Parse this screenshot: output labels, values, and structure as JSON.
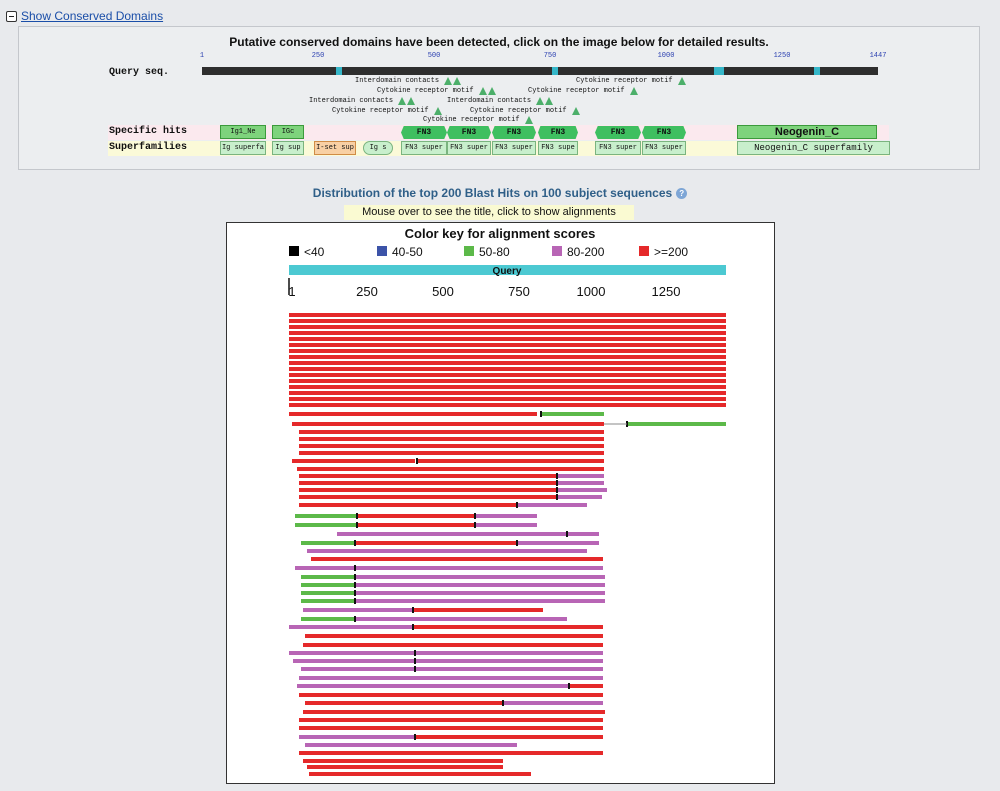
{
  "toggle": {
    "label": "Show Conserved Domains"
  },
  "conserved_domains": {
    "header": "Putative conserved domains have been detected, click on the image below for detailed results.",
    "query_label": "Query seq.",
    "specific_hits_label": "Specific hits",
    "superfamilies_label": "Superfamilies",
    "ruler_ticks": [
      "1",
      "250",
      "500",
      "750",
      "1000",
      "1250",
      "1447"
    ],
    "motif_rows": [
      [
        {
          "text": "Interdomain contacts",
          "tri": [
            1,
            2
          ]
        },
        {
          "text": "Cytokine receptor motif",
          "tri": [
            1
          ]
        }
      ],
      [
        {
          "text": "Cytokine receptor motif",
          "tri": [
            1,
            2
          ]
        },
        {
          "text": "Cytokine receptor motif",
          "tri": [
            1
          ]
        }
      ],
      [
        {
          "text": "Interdomain contacts",
          "tri": [
            1,
            2
          ]
        },
        {
          "text": "Interdomain contacts",
          "tri": [
            1,
            2
          ]
        }
      ],
      [
        {
          "text": "Cytokine receptor motif",
          "tri": [
            1
          ]
        },
        {
          "text": "Cytokine receptor motif",
          "tri": [
            1
          ]
        }
      ],
      [
        {
          "text": "Cytokine receptor motif",
          "tri": [
            1
          ]
        }
      ]
    ],
    "specific_hits": [
      {
        "label": "Ig1_Ne",
        "kind": "box"
      },
      {
        "label": "IGc",
        "kind": "box"
      },
      {
        "label": "FN3",
        "kind": "fn3"
      },
      {
        "label": "FN3",
        "kind": "fn3"
      },
      {
        "label": "FN3",
        "kind": "fn3"
      },
      {
        "label": "FN3",
        "kind": "fn3"
      },
      {
        "label": "FN3",
        "kind": "fn3"
      },
      {
        "label": "FN3",
        "kind": "fn3"
      },
      {
        "label": "Neogenin_C",
        "kind": "big"
      }
    ],
    "superfamilies": [
      {
        "label": "Ig superfa"
      },
      {
        "label": "Ig sup"
      },
      {
        "label": "I-set sup",
        "kind": "orange"
      },
      {
        "label": "Ig s",
        "kind": "pill"
      },
      {
        "label": "FN3 super"
      },
      {
        "label": "FN3 super"
      },
      {
        "label": "FN3 super"
      },
      {
        "label": "FN3 supe"
      },
      {
        "label": "FN3 super"
      },
      {
        "label": "FN3 super"
      },
      {
        "label": "Neogenin_C superfamily"
      }
    ]
  },
  "blast": {
    "title": "Distribution of the top 200 Blast Hits on 100 subject sequences",
    "hint": "Mouse over to see the title, click to show alignments",
    "color_key_title": "Color key for alignment scores",
    "legend": [
      {
        "label": "<40",
        "color": "#000000"
      },
      {
        "label": "40-50",
        "color": "#3c53a8"
      },
      {
        "label": "50-80",
        "color": "#5cb949"
      },
      {
        "label": "80-200",
        "color": "#b865b5"
      },
      {
        "label": ">=200",
        "color": "#e5292a"
      }
    ],
    "query_label": "Query",
    "query_bar_color": "#4cc9d2",
    "ticks": [
      "1",
      "250",
      "500",
      "750",
      "1000",
      "1250"
    ]
  }
}
